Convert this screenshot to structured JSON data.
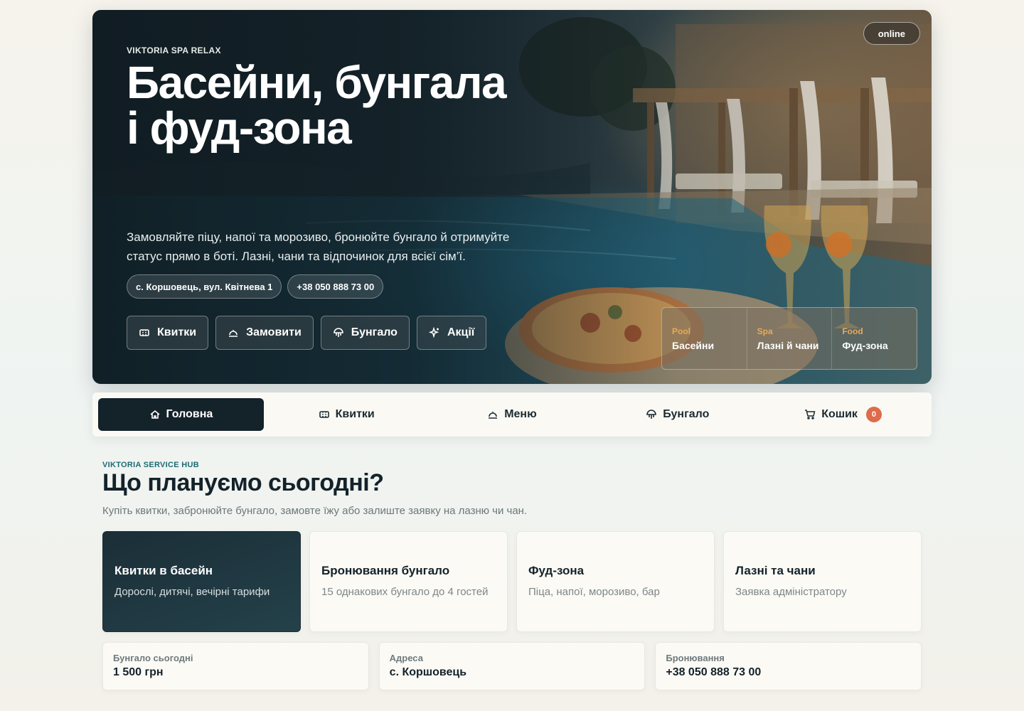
{
  "hero": {
    "brand": "VIKTORIA SPA RELAX",
    "title": "Басейни, бунгала і фуд-зона",
    "subtitle": "Замовляйте піцу, напої та морозиво, бронюйте бунгало й отримуйте статус прямо в боті. Лазні, чани та відпочинок для всієї сім’ї.",
    "status": "online",
    "chips": [
      {
        "label": "с. Коршовець, вул. Квітнева 1"
      },
      {
        "label": "+38 050 888 73 00"
      }
    ],
    "actions": [
      {
        "label": "Квитки",
        "icon": "ticket-icon"
      },
      {
        "label": "Замовити",
        "icon": "cloche-icon"
      },
      {
        "label": "Бунгало",
        "icon": "umbrella-icon"
      },
      {
        "label": "Акції",
        "icon": "sparkle-icon"
      }
    ],
    "features": [
      {
        "tag": "Pool",
        "name": "Басейни"
      },
      {
        "tag": "Spa",
        "name": "Лазні й чани"
      },
      {
        "tag": "Food",
        "name": "Фуд-зона"
      }
    ]
  },
  "nav": {
    "items": [
      {
        "label": "Головна",
        "icon": "home-icon",
        "active": true
      },
      {
        "label": "Квитки",
        "icon": "ticket-icon"
      },
      {
        "label": "Меню",
        "icon": "cloche-icon"
      },
      {
        "label": "Бунгало",
        "icon": "umbrella-icon"
      },
      {
        "label": "Кошик",
        "icon": "cart-icon",
        "badge": "0"
      }
    ]
  },
  "section": {
    "eyebrow": "VIKTORIA SERVICE HUB",
    "title": "Що плануємо сьогодні?",
    "description": "Купіть квитки, забронюйте бунгало, замовте їжу або залиште заявку на лазню чи чан."
  },
  "services": [
    {
      "title": "Квитки в басейн",
      "description": "Дорослі, дитячі, вечірні тарифи",
      "active": true
    },
    {
      "title": "Бронювання бунгало",
      "description": "15 однакових бунгало до 4 гостей"
    },
    {
      "title": "Фуд-зона",
      "description": "Піца, напої, морозиво, бар"
    },
    {
      "title": "Лазні та чани",
      "description": "Заявка адміністратору"
    }
  ],
  "stats": [
    {
      "label": "Бунгало сьогодні",
      "value": "1 500 грн"
    },
    {
      "label": "Адреса",
      "value": "с. Коршовець"
    },
    {
      "label": "Бронювання",
      "value": "+38 050 888 73 00"
    }
  ],
  "colors": {
    "dark": "#14222a",
    "accent_teal": "#1d6b74",
    "accent_orange": "#e6a95a",
    "badge": "#df6b4a",
    "background": "#f6f3ec"
  }
}
